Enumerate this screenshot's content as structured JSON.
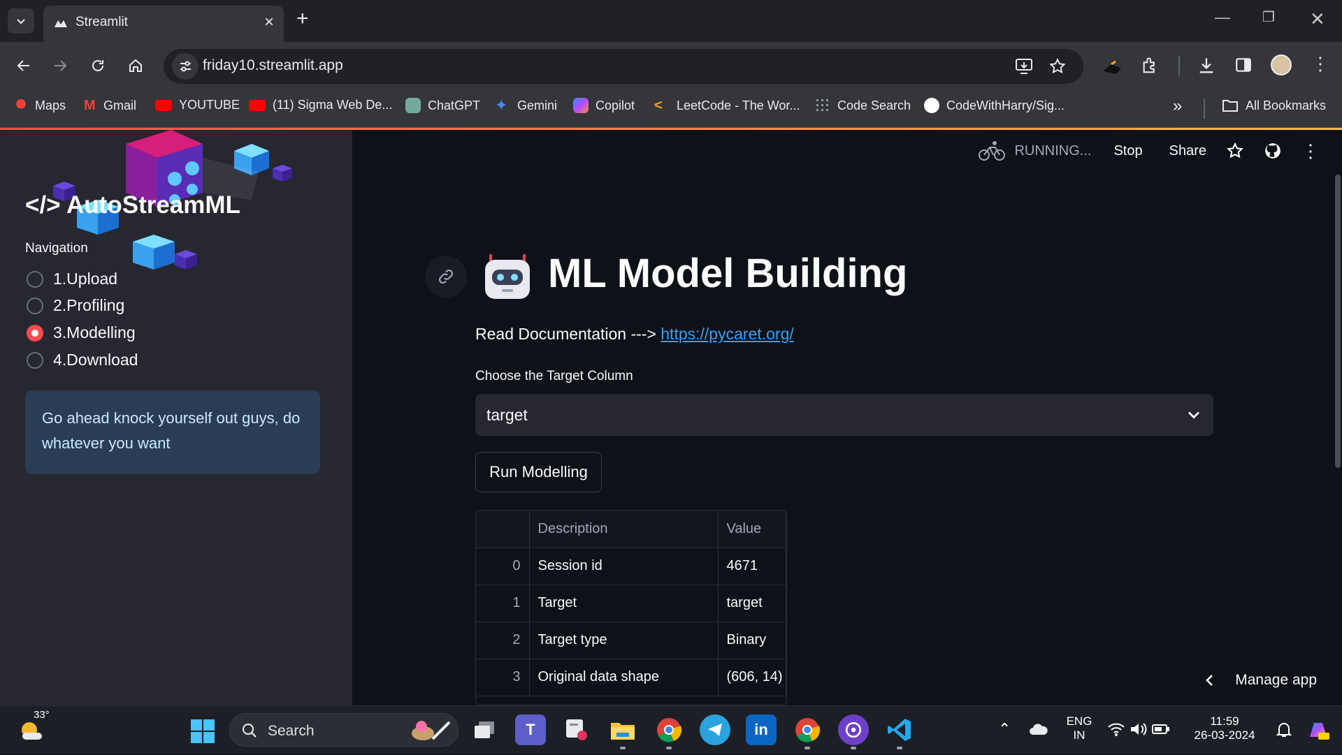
{
  "browser": {
    "tab_title": "Streamlit",
    "url": "friday10.streamlit.app",
    "bookmarks": [
      {
        "label": "Maps",
        "icon": "maps-icon",
        "color": "#ea4335"
      },
      {
        "label": "Gmail",
        "icon": "gmail-icon",
        "color": "#ea4335"
      },
      {
        "label": "YOUTUBE",
        "icon": "youtube-icon",
        "color": "#ff0000"
      },
      {
        "label": "(11) Sigma Web De...",
        "icon": "youtube-icon",
        "color": "#ff0000"
      },
      {
        "label": "ChatGPT",
        "icon": "chatgpt-icon",
        "color": "#74aa9c"
      },
      {
        "label": "Gemini",
        "icon": "gemini-icon",
        "color": "#4b8bf5"
      },
      {
        "label": "Copilot",
        "icon": "copilot-icon",
        "color": "#8a6cff"
      },
      {
        "label": "LeetCode - The Wor...",
        "icon": "leetcode-icon",
        "color": "#ffa116"
      },
      {
        "label": "Code Search",
        "icon": "code-search-icon",
        "color": "#9aa0a6"
      },
      {
        "label": "CodeWithHarry/Sig...",
        "icon": "github-icon",
        "color": "#ffffff"
      }
    ],
    "all_bookmarks": "All Bookmarks"
  },
  "sidebar": {
    "brand": "</> AutoStreamML",
    "nav_label": "Navigation",
    "options": [
      "1.Upload",
      "2.Profiling",
      "3.Modelling",
      "4.Download"
    ],
    "selected": "3.Modelling",
    "info": "Go ahead knock yourself out guys, do whatever you want"
  },
  "header": {
    "status": "RUNNING...",
    "stop": "Stop",
    "share": "Share"
  },
  "main": {
    "title": "ML Model Building",
    "doc_prefix": "Read Documentation --->",
    "doc_link": "https://pycaret.org/",
    "select_label": "Choose the Target Column",
    "select_value": "target",
    "run_button": "Run Modelling",
    "table": {
      "columns": [
        "",
        "Description",
        "Value"
      ],
      "rows": [
        [
          "0",
          "Session id",
          "4671"
        ],
        [
          "1",
          "Target",
          "target"
        ],
        [
          "2",
          "Target type",
          "Binary"
        ],
        [
          "3",
          "Original data shape",
          "(606, 14)"
        ]
      ]
    },
    "manage_app": "Manage app"
  },
  "taskbar": {
    "temperature": "33°",
    "search": "Search",
    "lang_top": "ENG",
    "lang_bottom": "IN",
    "time": "11:59",
    "date": "26-03-2024"
  },
  "colors": {
    "accent": "#ff4b4b",
    "link": "#3d9df3",
    "sidebar_bg": "#262730",
    "main_bg": "#0e1117"
  }
}
